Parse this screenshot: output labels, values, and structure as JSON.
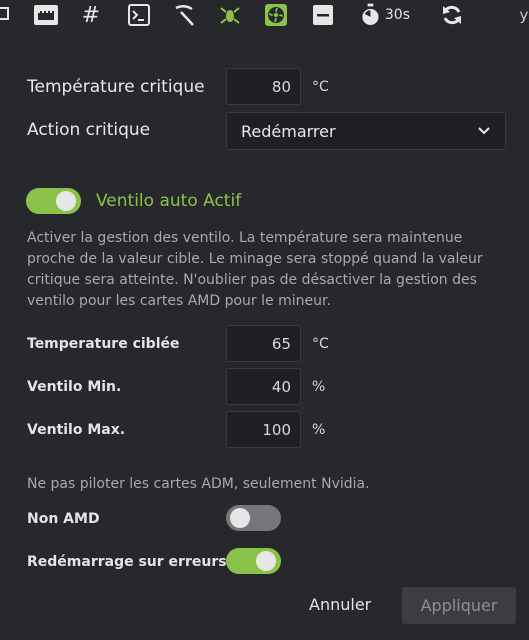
{
  "toolbar": {
    "icons": [
      "monitor-icon",
      "ethernet-icon",
      "hash-icon",
      "terminal-icon",
      "pickaxe-icon",
      "bug-icon",
      "fan-icon",
      "minus-icon",
      "stopwatch-icon",
      "refresh-icon"
    ],
    "timer_label": "30s"
  },
  "critical": {
    "temperature_label": "Température critique",
    "temperature_value": "80",
    "temperature_unit": "°C",
    "action_label": "Action critique",
    "action_value": "Redémarrer"
  },
  "fan": {
    "toggle_label": "Ventilo auto Actif",
    "enabled": true,
    "description": "Activer la gestion des ventilo. La température sera maintenue proche de la valeur cible. Le minage sera stoppé quand la valeur critique sera atteinte. N'oublier pas de désactiver la gestion des ventilo pour les cartes AMD pour le mineur.",
    "target_temp_label": "Temperature ciblée",
    "target_temp_value": "65",
    "target_temp_unit": "°C",
    "min_label": "Ventilo Min.",
    "min_value": "40",
    "min_unit": "%",
    "max_label": "Ventilo Max.",
    "max_value": "100",
    "max_unit": "%"
  },
  "options": {
    "note": "Ne pas piloter les cartes ADM, seulement Nvidia.",
    "non_amd_label": "Non AMD",
    "non_amd_enabled": false,
    "restart_on_error_label": "Redémarrage sur erreurs",
    "restart_on_error_enabled": true
  },
  "actions": {
    "cancel_label": "Annuler",
    "apply_label": "Appliquer"
  },
  "colors": {
    "accent": "#8bc34a",
    "background": "#27282c"
  }
}
